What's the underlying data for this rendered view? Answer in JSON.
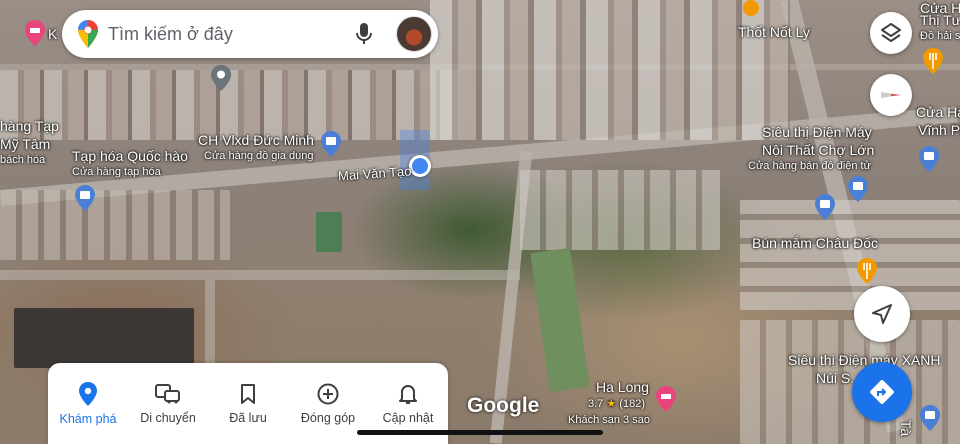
{
  "search": {
    "placeholder": "Tìm kiếm ở đây"
  },
  "map": {
    "street": "Mai Văn Tạo",
    "places": [
      {
        "name": "CH Vlxd Đức Minh",
        "sub": "Cửa hàng đồ gia dụng"
      },
      {
        "name": "Tạp hóa Quốc hào",
        "sub": "Cửa hàng tạp hóa"
      },
      {
        "name": "Thốt Nốt Ly"
      },
      {
        "name": "Siêu thị Điện Máy",
        "name2": "Nội Thất Chợ Lớn",
        "sub": "Cửa hàng bán đồ điện tử"
      },
      {
        "name": "Bún mắm Châu Đốc"
      },
      {
        "name": "Siêu thị Điện máy XANH",
        "name2": "Núi S... Giang"
      },
      {
        "name": "Ha Long",
        "rating": "3.7",
        "reviews": "(182)",
        "sub": "Khách sạn 3 sao"
      }
    ],
    "edge_labels": {
      "left1": "hàng Tạp",
      "left2": "Mỹ Tâm",
      "left3": "bách hóa",
      "top_left": "K",
      "right1": "Cửa H",
      "right2": "Thị Tư",
      "right3": "Đồ hải s",
      "right4": "Cửa Hà",
      "right5": "Vĩnh Pl",
      "right_bottom": "Tà"
    },
    "logo": "Google",
    "colors": {
      "accent": "#1a73e8",
      "location_dot": "#4285f4",
      "hotel_pin": "#e8457c",
      "shop_pin": "#4b7fd6",
      "food_pin": "#f29900"
    }
  },
  "controls": {
    "layers_icon": "layers-icon",
    "compass_icon": "compass-icon",
    "locate_icon": "navigation-arrow-icon",
    "directions_icon": "directions-icon"
  },
  "nav": [
    {
      "label": "Khám phá",
      "icon": "explore-pin-icon",
      "active": true
    },
    {
      "label": "Di chuyển",
      "icon": "commute-icon"
    },
    {
      "label": "Đã lưu",
      "icon": "bookmark-icon"
    },
    {
      "label": "Đóng góp",
      "icon": "add-circle-icon"
    },
    {
      "label": "Cập nhật",
      "icon": "bell-icon"
    }
  ]
}
